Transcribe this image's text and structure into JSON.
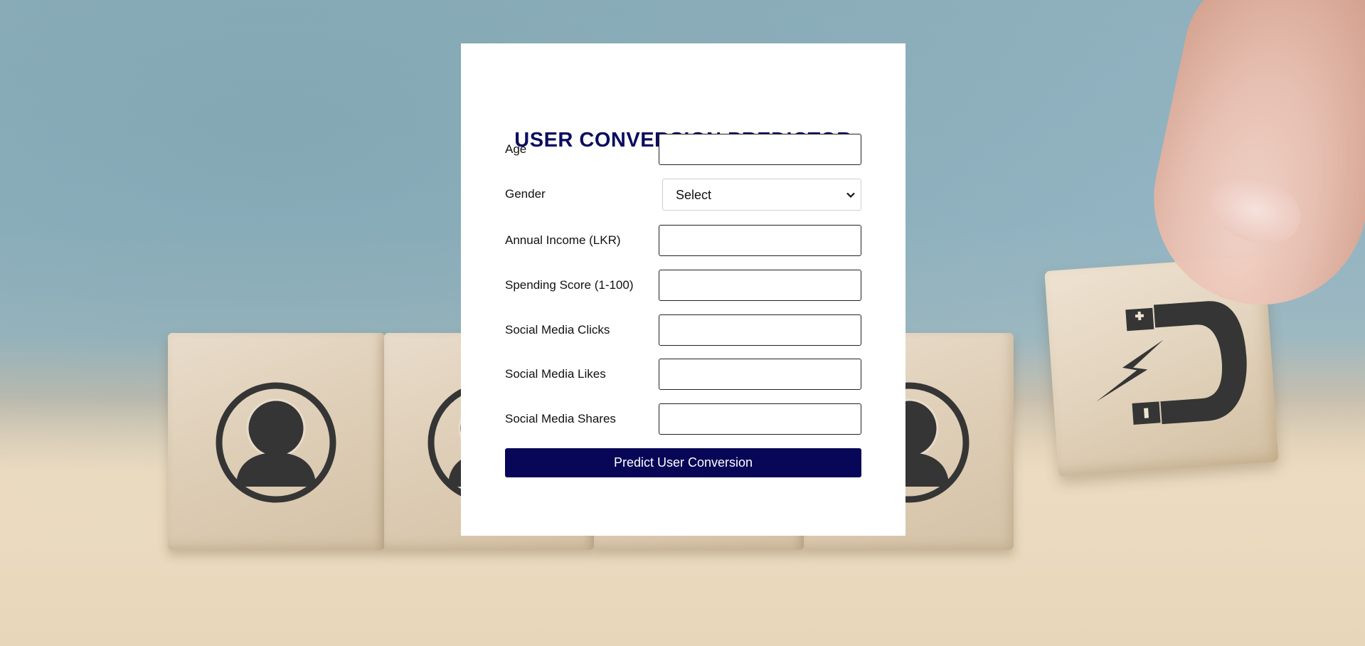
{
  "form": {
    "title": "USER CONVERSION PREDICTOR",
    "fields": [
      {
        "label": "Age",
        "value": ""
      },
      {
        "label": "Gender",
        "selected": "Select"
      },
      {
        "label": "Annual Income (LKR)",
        "value": ""
      },
      {
        "label": "Spending Score (1-100)",
        "value": ""
      },
      {
        "label": "Social Media Clicks",
        "value": ""
      },
      {
        "label": "Social Media Likes",
        "value": ""
      },
      {
        "label": "Social Media Shares",
        "value": ""
      }
    ],
    "submit_label": "Predict User Conversion"
  },
  "colors": {
    "title": "#0c0c5e",
    "button_bg": "#080657",
    "button_text": "#ffffff",
    "card_bg": "#ffffff"
  },
  "icons": {
    "select_chevron": "chevron-down-icon",
    "cube_icons": [
      "person-icon",
      "person-icon",
      "person-icon",
      "magnet-icon"
    ]
  }
}
